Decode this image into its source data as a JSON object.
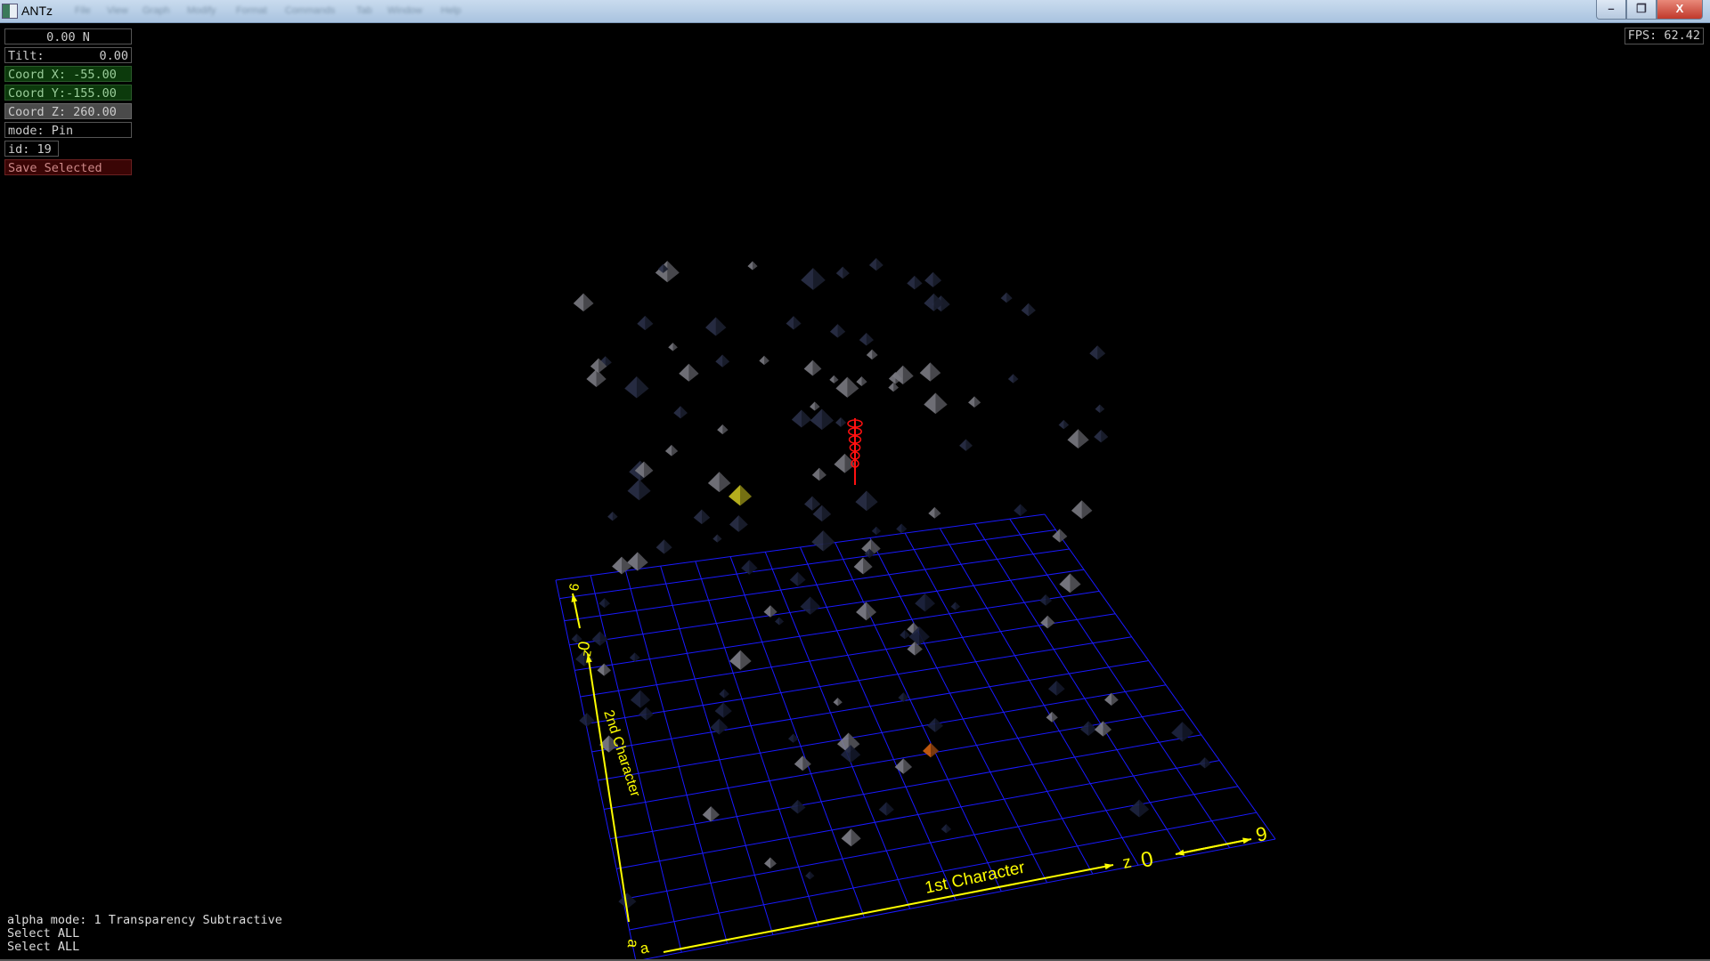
{
  "window": {
    "title": "ANTz",
    "menu": [
      "File",
      "View",
      "Graph",
      "Modify",
      "Format",
      "Commands",
      "Tab",
      "Window",
      "Help"
    ],
    "controls": {
      "minimize": "–",
      "restore": "❐",
      "close": "X"
    }
  },
  "panel": {
    "heading": "0.00 N",
    "tilt_label": "Tilt:",
    "tilt_value": "0.00",
    "coord_x": "Coord X: -55.00",
    "coord_y": "Coord Y:-155.00",
    "coord_z": "Coord Z: 260.00",
    "mode": "mode: Pin",
    "id": "id: 19",
    "save": "Save Selected"
  },
  "fps": "FPS: 62.42",
  "status": [
    "alpha mode: 1 Transparency Subtractive",
    "Select ALL",
    "Select ALL"
  ],
  "axes": {
    "x_label": "1st Character",
    "x_z": "z",
    "x_zero": "0",
    "x_nine": "9",
    "y_label": "2nd Character",
    "y_z": "z",
    "y_zero": "0",
    "y_nine": "9",
    "y_a": "a",
    "x_a": "a"
  },
  "colors": {
    "grid": "#1a1aff",
    "axis": "#ffff00",
    "marker": "#ff1010",
    "selected": "#c8c020",
    "highlight": "#d06010"
  }
}
